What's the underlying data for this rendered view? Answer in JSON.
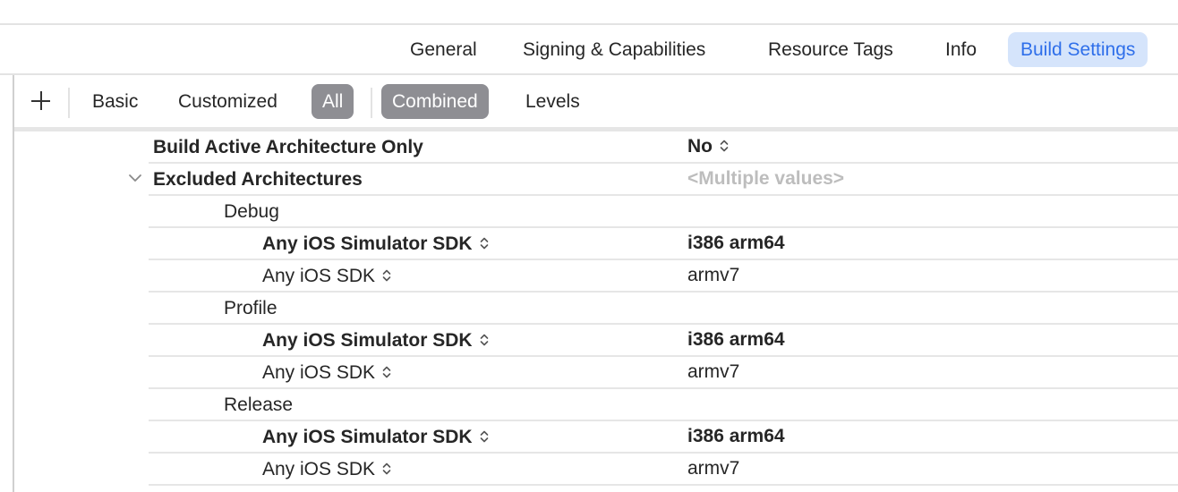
{
  "tabs": [
    {
      "label": "General",
      "active": false
    },
    {
      "label": "Signing & Capabilities",
      "active": false
    },
    {
      "label": "Resource Tags",
      "active": false
    },
    {
      "label": "Info",
      "active": false
    },
    {
      "label": "Build Settings",
      "active": true
    }
  ],
  "filter_bar": {
    "add_icon": "plus-icon",
    "scope_buttons": [
      {
        "label": "Basic",
        "selected": false
      },
      {
        "label": "Customized",
        "selected": false
      },
      {
        "label": "All",
        "selected": true
      }
    ],
    "view_buttons": [
      {
        "label": "Combined",
        "selected": true
      },
      {
        "label": "Levels",
        "selected": false
      }
    ]
  },
  "settings": [
    {
      "name": "Build Active Architecture Only",
      "value": "No",
      "name_bold": true,
      "value_bold": true,
      "value_has_stepper": true,
      "level": 0
    },
    {
      "name": "Excluded Architectures",
      "value": "<Multiple values>",
      "name_bold": true,
      "value_dim": true,
      "expanded": true,
      "level": 0
    },
    {
      "name": "Debug",
      "value": "",
      "level": 1
    },
    {
      "name": "Any iOS Simulator SDK",
      "value": "i386 arm64",
      "name_bold": true,
      "value_bold": true,
      "name_has_stepper": true,
      "level": 2
    },
    {
      "name": "Any iOS SDK",
      "value": "armv7",
      "name_has_stepper": true,
      "level": 2
    },
    {
      "name": "Profile",
      "value": "",
      "level": 1
    },
    {
      "name": "Any iOS Simulator SDK",
      "value": "i386 arm64",
      "name_bold": true,
      "value_bold": true,
      "name_has_stepper": true,
      "level": 2
    },
    {
      "name": "Any iOS SDK",
      "value": "armv7",
      "name_has_stepper": true,
      "level": 2
    },
    {
      "name": "Release",
      "value": "",
      "level": 1
    },
    {
      "name": "Any iOS Simulator SDK",
      "value": "i386 arm64",
      "name_bold": true,
      "value_bold": true,
      "name_has_stepper": true,
      "level": 2
    },
    {
      "name": "Any iOS SDK",
      "value": "armv7",
      "name_has_stepper": true,
      "level": 2
    }
  ],
  "colors": {
    "accent": "#2f6fea",
    "accent_bg": "#d5e4fb",
    "selected_segment": "#8e8e93",
    "separator": "#e6e6e6",
    "placeholder_text": "#bdbdbd"
  }
}
